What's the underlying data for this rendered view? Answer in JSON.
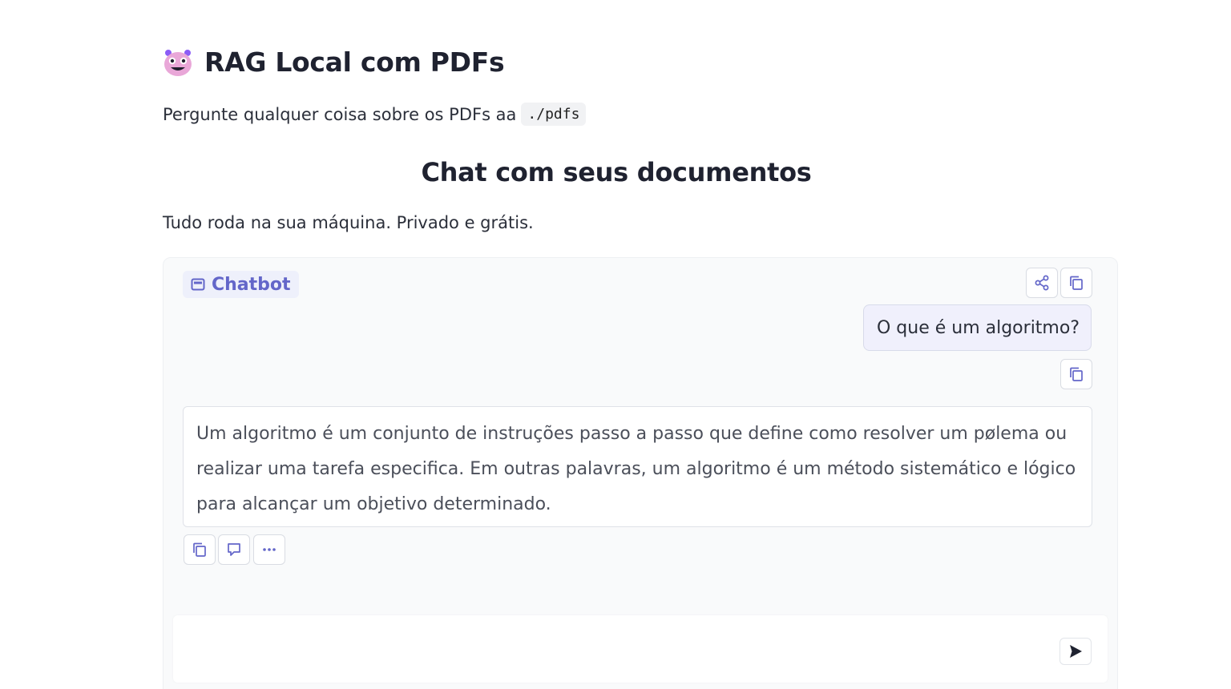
{
  "header": {
    "title": "RAG Local com PDFs",
    "title_icon": "robot-emoji-icon",
    "subtitle_text": "Pergunte qualquer coisa sobre os PDFs aa",
    "subtitle_code": "./pdfs"
  },
  "section": {
    "title": "Chat com seus documentos",
    "tagline": "Tudo roda na sua máquina. Privado e grátis."
  },
  "chatbot": {
    "label": "Chatbot",
    "label_icon": "chat-window-icon",
    "accent_color": "#6366c9",
    "header_actions": [
      "share-icon",
      "copy-icon"
    ],
    "messages": [
      {
        "role": "user",
        "text": "O que é um algoritmo?",
        "actions": [
          "copy-icon"
        ]
      },
      {
        "role": "assistant",
        "text": "Um algoritmo é um conjunto de instruções passo a passo que define como resolver um pølema ou realizar uma tarefa especifica. Em outras palavras, um algoritmo é um método sistemático e lógico para alcançar um objetivo determinado.",
        "actions": [
          "copy-icon",
          "comment-icon",
          "more-icon"
        ]
      }
    ]
  },
  "composer": {
    "value": "",
    "placeholder": "",
    "send_icon": "send-icon"
  }
}
